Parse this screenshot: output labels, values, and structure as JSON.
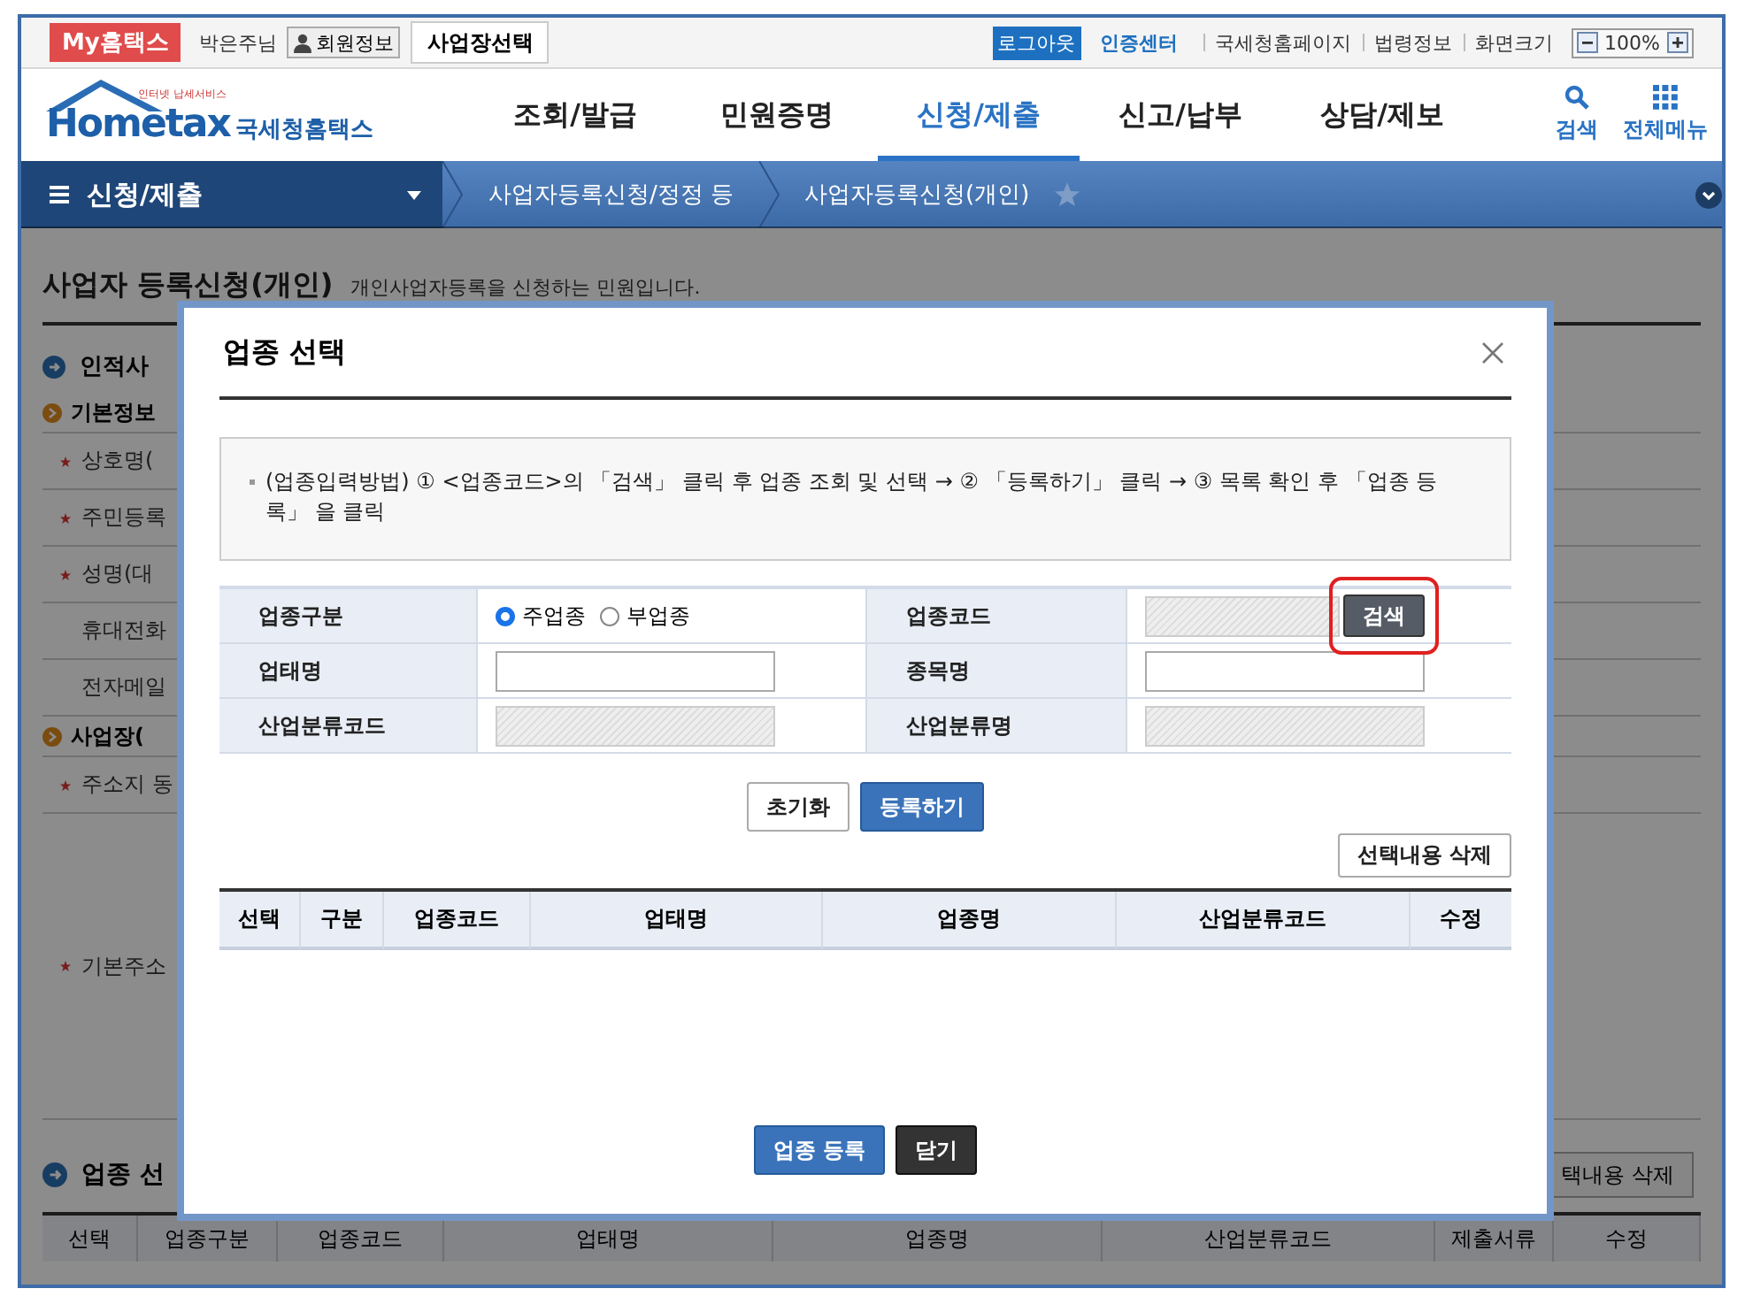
{
  "top_bar": {
    "my_hometax": "My홈택스",
    "user": "박은주님",
    "member_info": "회원정보",
    "business_select": "사업장선택",
    "logout": "로그아웃",
    "cert_center": "인증센터",
    "links": [
      "국세청홈페이지",
      "법령정보"
    ],
    "zoom_label": "화면크기",
    "zoom_value": "100%"
  },
  "header": {
    "logo_small": "인터넷 납세서비스",
    "logo_main": "Hometax",
    "logo_name": "국세청홈택스",
    "nav": [
      {
        "label": "조회/발급",
        "selected": false
      },
      {
        "label": "민원증명",
        "selected": false
      },
      {
        "label": "신청/제출",
        "selected": true
      },
      {
        "label": "신고/납부",
        "selected": false
      },
      {
        "label": "상담/제보",
        "selected": false
      }
    ],
    "tools": [
      {
        "kind": "search",
        "label": "검색"
      },
      {
        "kind": "menu",
        "label": "전체메뉴"
      }
    ]
  },
  "breadcrumb": {
    "menu": "신청/제출",
    "items": [
      "사업자등록신청/정정 등",
      "사업자등록신청(개인)"
    ]
  },
  "page": {
    "title": "사업자 등록신청(개인)",
    "description": "개인사업자등록을 신청하는 민원입니다.",
    "items": [
      {
        "kind": "section",
        "label": "인적사"
      },
      {
        "kind": "subsection",
        "label": "기본정보"
      },
      {
        "kind": "field",
        "label": "상호명(",
        "required": true
      },
      {
        "kind": "field",
        "label": "주민등록",
        "required": true
      },
      {
        "kind": "field",
        "label": "성명(대",
        "required": true
      },
      {
        "kind": "field",
        "label": "휴대전화",
        "required": false
      },
      {
        "kind": "field",
        "label": "전자메일",
        "required": false
      },
      {
        "kind": "subsection",
        "label": "사업장("
      },
      {
        "kind": "field",
        "label": "주소지 동",
        "required": true
      },
      {
        "kind": "address",
        "label": "기본주소",
        "required": true
      }
    ],
    "industry_title": "업종 선",
    "industry_delete": "택내용 삭제",
    "columns": [
      "선택",
      "업종구분",
      "업종코드",
      "업태명",
      "업종명",
      "산업분류코드",
      "제출서류",
      "수정"
    ]
  },
  "modal": {
    "title": "업종 선택",
    "instruction": "(업종입력방법) ① <업종코드>의 「검색」 클릭 후 업종 조회 및 선택 → ② 「등록하기」 클릭 → ③ 목록 확인 후 「업종 등록」 을 클릭",
    "form": [
      {
        "label": "업종구분",
        "kind": "radio",
        "options": [
          {
            "label": "주업종",
            "selected": true
          },
          {
            "label": "부업종",
            "selected": false
          }
        ]
      },
      {
        "label": "업종코드",
        "kind": "search",
        "button": "검색",
        "highlighted": true
      },
      {
        "label": "업태명",
        "kind": "text"
      },
      {
        "label": "종목명",
        "kind": "text"
      },
      {
        "label": "산업분류코드",
        "kind": "readonly"
      },
      {
        "label": "산업분류명",
        "kind": "readonly"
      }
    ],
    "actions": [
      {
        "label": "초기화",
        "kind": "default"
      },
      {
        "label": "등록하기",
        "kind": "primary"
      }
    ],
    "delete_button": "선택내용 삭제",
    "columns": [
      "선택",
      "구분",
      "업종코드",
      "업태명",
      "업종명",
      "산업분류코드",
      "수정"
    ],
    "footer_buttons": [
      {
        "label": "업종 등록",
        "kind": "primary"
      },
      {
        "label": "닫기",
        "kind": "dark"
      }
    ]
  }
}
